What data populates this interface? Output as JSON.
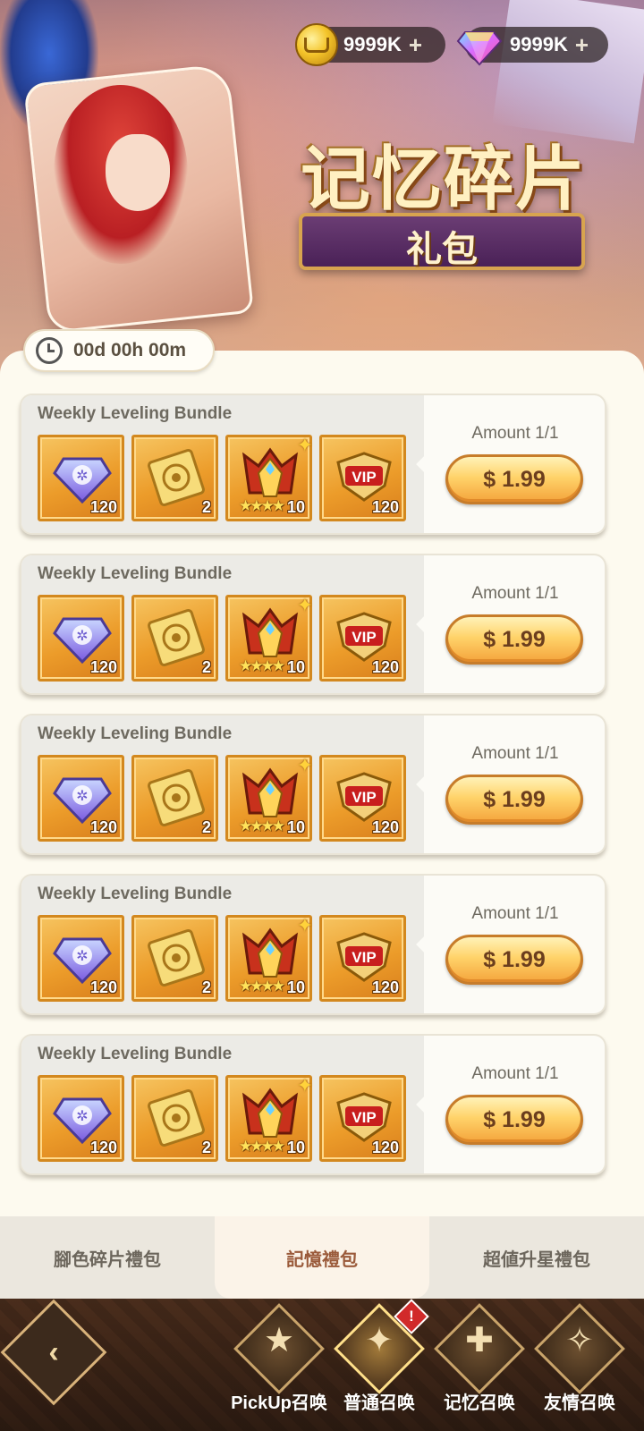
{
  "header": {
    "title_main": "记忆碎片",
    "title_sub": "礼包",
    "coins": {
      "value": "9999K",
      "plus": "+"
    },
    "gems": {
      "value": "9999K",
      "plus": "+"
    }
  },
  "timer": {
    "text": "00d 00h 00m"
  },
  "bundles": [
    {
      "name": "Weekly Leveling Bundle",
      "amount": "Amount 1/1",
      "price": "$ 1.99",
      "items": [
        {
          "icon": "diamond-crest-icon",
          "qty": "120"
        },
        {
          "icon": "gold-ticket-icon",
          "qty": "2"
        },
        {
          "icon": "crown-emblem-icon",
          "qty": "10",
          "stars": "★★★★"
        },
        {
          "icon": "vip-badge-icon",
          "qty": "120"
        }
      ]
    },
    {
      "name": "Weekly Leveling Bundle",
      "amount": "Amount 1/1",
      "price": "$ 1.99",
      "items": [
        {
          "icon": "diamond-crest-icon",
          "qty": "120"
        },
        {
          "icon": "gold-ticket-icon",
          "qty": "2"
        },
        {
          "icon": "crown-emblem-icon",
          "qty": "10",
          "stars": "★★★★"
        },
        {
          "icon": "vip-badge-icon",
          "qty": "120"
        }
      ]
    },
    {
      "name": "Weekly Leveling Bundle",
      "amount": "Amount 1/1",
      "price": "$ 1.99",
      "items": [
        {
          "icon": "diamond-crest-icon",
          "qty": "120"
        },
        {
          "icon": "gold-ticket-icon",
          "qty": "2"
        },
        {
          "icon": "crown-emblem-icon",
          "qty": "10",
          "stars": "★★★★"
        },
        {
          "icon": "vip-badge-icon",
          "qty": "120"
        }
      ]
    },
    {
      "name": "Weekly Leveling Bundle",
      "amount": "Amount 1/1",
      "price": "$ 1.99",
      "items": [
        {
          "icon": "diamond-crest-icon",
          "qty": "120"
        },
        {
          "icon": "gold-ticket-icon",
          "qty": "2"
        },
        {
          "icon": "crown-emblem-icon",
          "qty": "10",
          "stars": "★★★★"
        },
        {
          "icon": "vip-badge-icon",
          "qty": "120"
        }
      ]
    },
    {
      "name": "Weekly Leveling Bundle",
      "amount": "Amount 1/1",
      "price": "$ 1.99",
      "items": [
        {
          "icon": "diamond-crest-icon",
          "qty": "120"
        },
        {
          "icon": "gold-ticket-icon",
          "qty": "2"
        },
        {
          "icon": "crown-emblem-icon",
          "qty": "10",
          "stars": "★★★★"
        },
        {
          "icon": "vip-badge-icon",
          "qty": "120"
        }
      ]
    }
  ],
  "tabs": [
    {
      "label": "腳色碎片禮包",
      "active": false
    },
    {
      "label": "記憶禮包",
      "active": true
    },
    {
      "label": "超値升星禮包",
      "active": false
    }
  ],
  "nav": {
    "back_glyph": "‹",
    "alert": "!",
    "items": [
      {
        "label": "PickUp召唤",
        "glyph": "★"
      },
      {
        "label": "普通召唤",
        "glyph": "✦"
      },
      {
        "label": "记忆召唤",
        "glyph": "✚"
      },
      {
        "label": "友情召唤",
        "glyph": "✧"
      }
    ]
  },
  "colors": {
    "panel_bg": "#fdfaef",
    "item_gold": "#ec9c2a",
    "buy_button": "#ffd36a",
    "active_tab_text": "#9a5a3a",
    "nav_bg": "#3a2416"
  }
}
